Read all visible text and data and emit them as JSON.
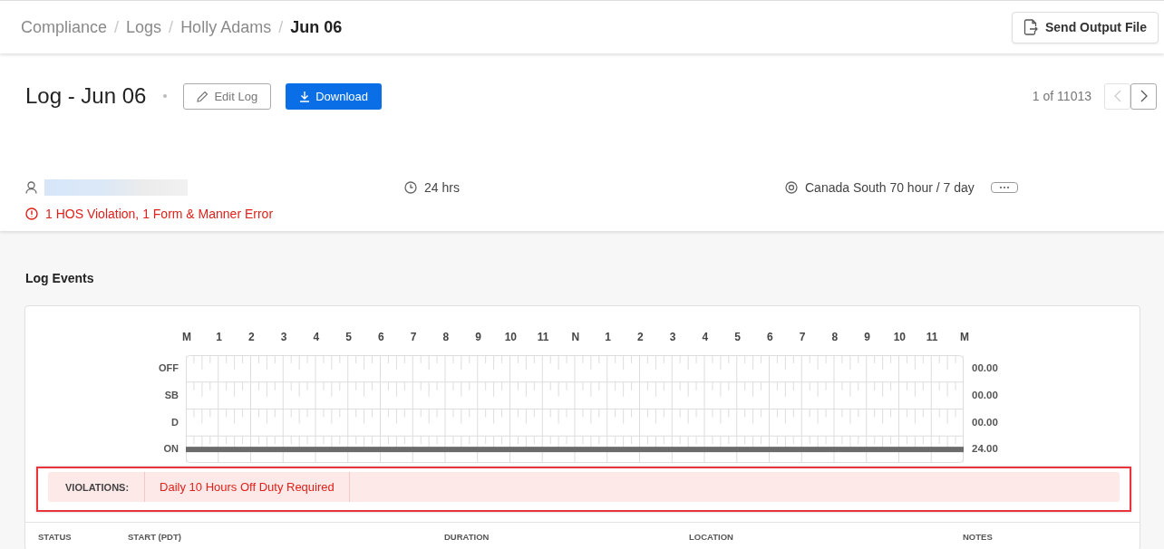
{
  "breadcrumb": [
    {
      "label": "Compliance",
      "current": false
    },
    {
      "label": "Logs",
      "current": false
    },
    {
      "label": "Holly Adams",
      "current": false
    },
    {
      "label": "Jun 06",
      "current": true
    }
  ],
  "breadcrumb_separator": "/",
  "send_button": {
    "label": "Send Output File"
  },
  "log": {
    "title": "Log - Jun 06",
    "edit_button": "Edit Log",
    "download_button": "Download"
  },
  "pager": {
    "text": "1 of 11013",
    "prev_disabled": true,
    "next_disabled": false
  },
  "info": {
    "duration": "24 hrs",
    "ruleset": "Canada South 70 hour / 7 day",
    "alert": "1 HOS Violation, 1 Form & Manner Error"
  },
  "log_events": {
    "title": "Log Events",
    "hours": [
      "M",
      "1",
      "2",
      "3",
      "4",
      "5",
      "6",
      "7",
      "8",
      "9",
      "10",
      "11",
      "N",
      "1",
      "2",
      "3",
      "4",
      "5",
      "6",
      "7",
      "8",
      "9",
      "10",
      "11",
      "M"
    ],
    "rows": [
      {
        "label": "OFF",
        "total": "00.00",
        "active": false
      },
      {
        "label": "SB",
        "total": "00.00",
        "active": false
      },
      {
        "label": "D",
        "total": "00.00",
        "active": false
      },
      {
        "label": "ON",
        "total": "24.00",
        "active": true
      }
    ],
    "violations": {
      "label": "VIOLATIONS:",
      "items": [
        "Daily 10 Hours Off Duty Required"
      ]
    },
    "columns": [
      "STATUS",
      "START (PDT)",
      "DURATION",
      "LOCATION",
      "NOTES"
    ]
  }
}
